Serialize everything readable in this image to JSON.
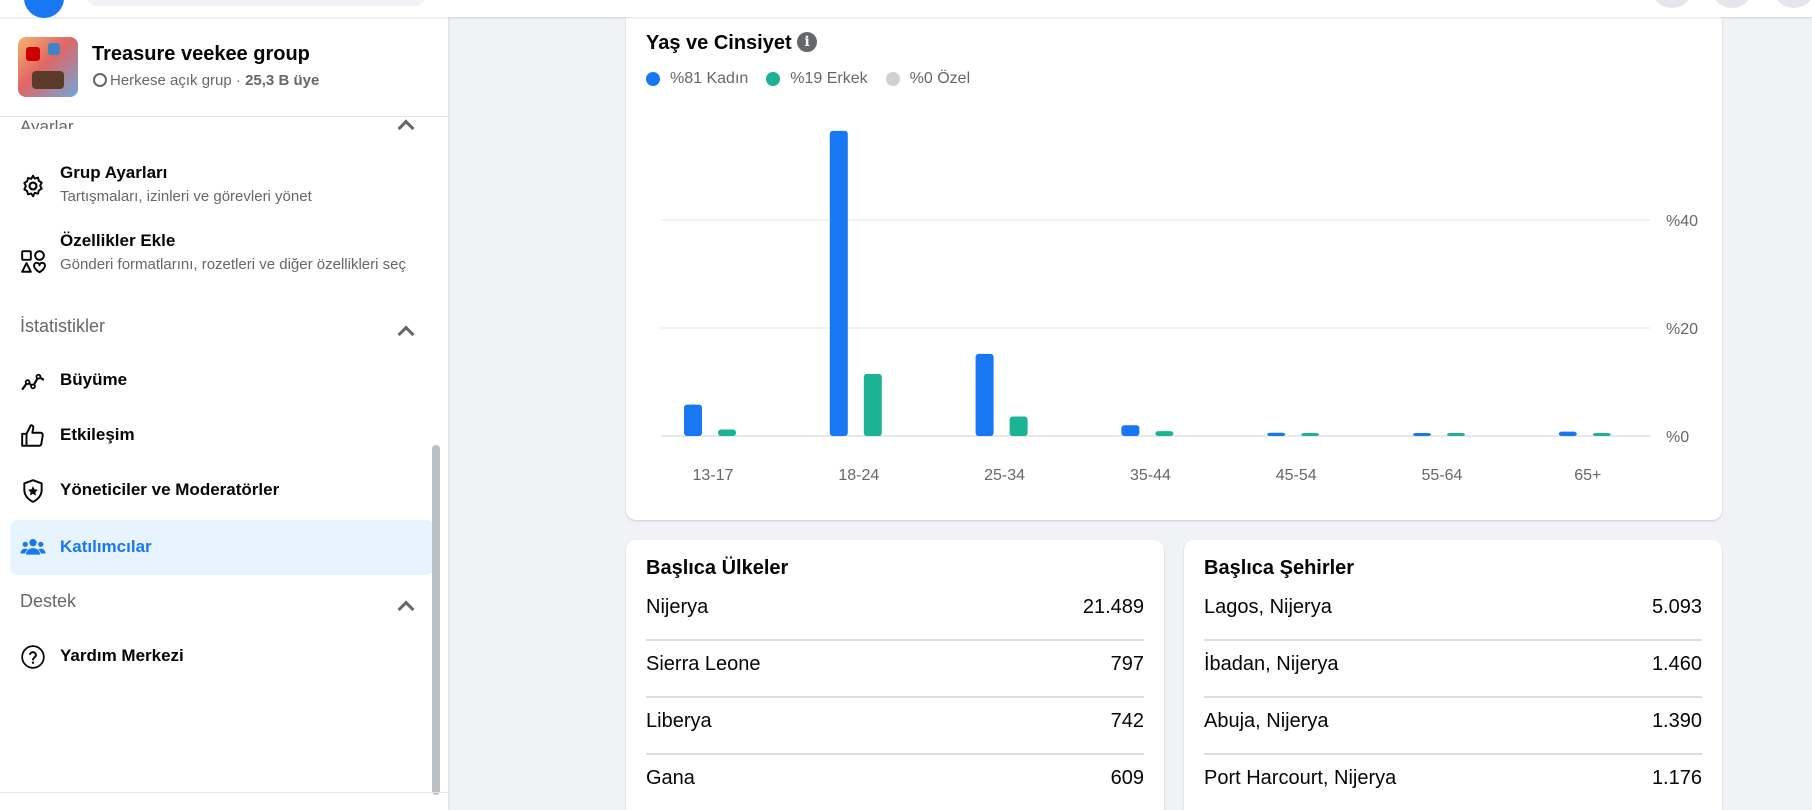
{
  "group": {
    "name": "Treasure veekee group",
    "privacy": "Herkese açık grup",
    "separator": " · ",
    "members": "25,3 B üye"
  },
  "sidebar": {
    "settings_section_cut": "Ayarlar",
    "settings_items": [
      {
        "title": "Grup Ayarları",
        "subtitle": "Tartışmaları, izinleri ve görevleri yönet",
        "icon": "gear-icon"
      },
      {
        "title": "Özellikler Ekle",
        "subtitle": "Gönderi formatlarını, rozetleri ve diğer özellikleri seç",
        "icon": "features-icon"
      }
    ],
    "stats_section": "İstatistikler",
    "stats_items": [
      {
        "title": "Büyüme",
        "icon": "growth-chart-icon"
      },
      {
        "title": "Etkileşim",
        "icon": "thumbs-up-icon"
      },
      {
        "title": "Yöneticiler ve Moderatörler",
        "icon": "shield-star-icon"
      },
      {
        "title": "Katılımcılar",
        "icon": "people-icon",
        "active": true
      }
    ],
    "support_section": "Destek",
    "support_items": [
      {
        "title": "Yardım Merkezi",
        "icon": "help-icon"
      }
    ]
  },
  "age_gender": {
    "title": "Yaş ve Cinsiyet",
    "legend": [
      {
        "label": "%81 Kadın",
        "color": "#1877f2"
      },
      {
        "label": "%19 Erkek",
        "color": "#1bb394"
      },
      {
        "label": "%0 Özel",
        "color": "#ced0d4"
      }
    ]
  },
  "chart_data": {
    "type": "bar",
    "title": "Yaş ve Cinsiyet",
    "categories": [
      "13-17",
      "18-24",
      "25-34",
      "35-44",
      "45-54",
      "55-64",
      "65+"
    ],
    "series": [
      {
        "name": "%81 Kadın",
        "color": "#1877f2",
        "values": [
          5.8,
          56.5,
          15.2,
          2.0,
          0.6,
          0.3,
          0.8
        ]
      },
      {
        "name": "%19 Erkek",
        "color": "#1bb394",
        "values": [
          1.2,
          11.5,
          3.6,
          0.9,
          0.5,
          0.3,
          0.3
        ]
      }
    ],
    "y_ticks": [
      "%0",
      "%20",
      "%40"
    ],
    "ylim": [
      0,
      60
    ],
    "grid": true,
    "legend_position": "top-left"
  },
  "countries": {
    "title": "Başlıca Ülkeler",
    "rows": [
      {
        "name": "Nijerya",
        "value": "21.489"
      },
      {
        "name": "Sierra Leone",
        "value": "797"
      },
      {
        "name": "Liberya",
        "value": "742"
      },
      {
        "name": "Gana",
        "value": "609"
      }
    ]
  },
  "cities": {
    "title": "Başlıca Şehirler",
    "rows": [
      {
        "name": "Lagos, Nijerya",
        "value": "5.093"
      },
      {
        "name": "İbadan, Nijerya",
        "value": "1.460"
      },
      {
        "name": "Abuja, Nijerya",
        "value": "1.390"
      },
      {
        "name": "Port Harcourt, Nijerya",
        "value": "1.176"
      }
    ]
  }
}
